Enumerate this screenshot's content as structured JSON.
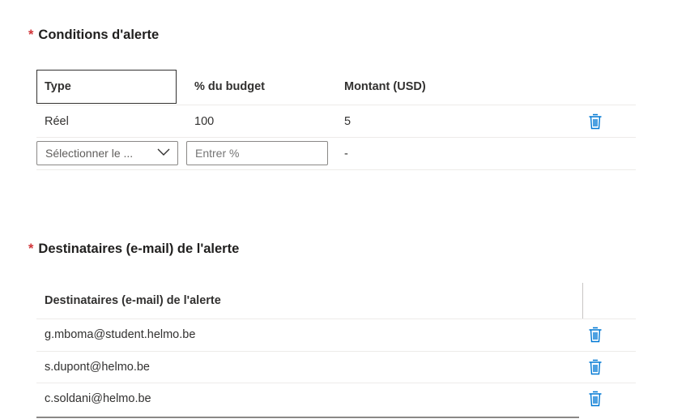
{
  "alert_conditions": {
    "title": "Conditions d'alerte",
    "required_mark": "*",
    "columns": {
      "type": "Type",
      "budget_pct": "% du budget",
      "amount": "Montant (USD)"
    },
    "rows": [
      {
        "type": "Réel",
        "budget_pct": "100",
        "amount": "5"
      }
    ],
    "new_row": {
      "type_placeholder": "Sélectionner le ...",
      "pct_placeholder": "Entrer %",
      "amount": "-"
    }
  },
  "alert_recipients": {
    "title": "Destinataires (e-mail) de l'alerte",
    "required_mark": "*",
    "column": "Destinataires (e-mail) de l'alerte",
    "emails": [
      "g.mboma@student.helmo.be",
      "s.dupont@helmo.be",
      "c.soldani@helmo.be"
    ]
  },
  "icons": {
    "delete": "trash-icon",
    "dropdown": "chevron-down-icon"
  },
  "colors": {
    "accent": "#0078d4",
    "required": "#d13438"
  }
}
